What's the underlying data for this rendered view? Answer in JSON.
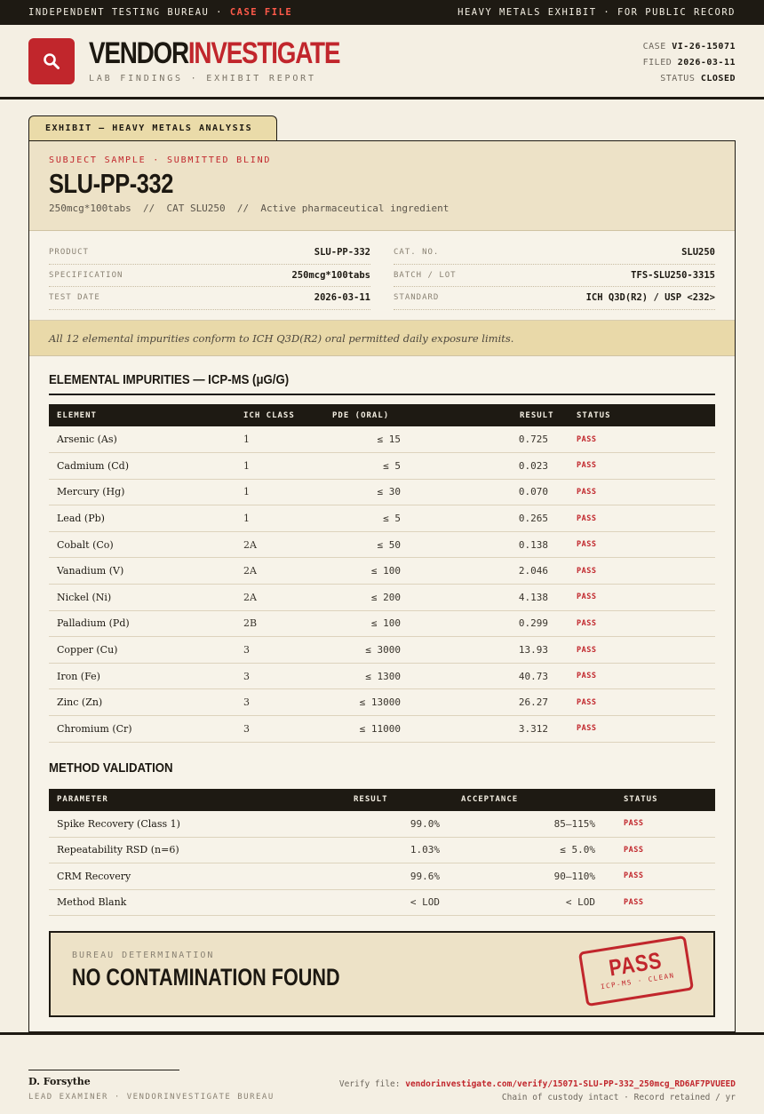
{
  "topbar": {
    "left": "INDEPENDENT TESTING BUREAU · ",
    "left_hl": "CASE FILE",
    "right": "HEAVY METALS EXHIBIT · FOR PUBLIC RECORD"
  },
  "header": {
    "brand_a": "VENDOR",
    "brand_b": "INVESTIGATE",
    "subtitle": "LAB FINDINGS · EXHIBIT REPORT",
    "case_label": "CASE",
    "case_value": "VI-26-15071",
    "filed_label": "FILED",
    "filed_value": "2026-03-11",
    "status_label": "STATUS",
    "status_value": "CLOSED",
    "logo_icon": "magnifier-icon",
    "accent": "#c1262c"
  },
  "exhibit": {
    "tab": "EXHIBIT — HEAVY METALS ANALYSIS",
    "subject_label": "SUBJECT SAMPLE · SUBMITTED BLIND",
    "title": "SLU-PP-332",
    "desc": "250mcg*100tabs  //  CAT SLU250  //  Active pharmaceutical ingredient",
    "specs_left": [
      {
        "k": "PRODUCT",
        "v": "SLU-PP-332"
      },
      {
        "k": "SPECIFICATION",
        "v": "250mcg*100tabs"
      },
      {
        "k": "TEST DATE",
        "v": "2026-03-11"
      }
    ],
    "specs_right": [
      {
        "k": "CAT. NO.",
        "v": "SLU250"
      },
      {
        "k": "BATCH / LOT",
        "v": "TFS-SLU250-3315"
      },
      {
        "k": "STANDARD",
        "v": "ICH Q3D(R2) / USP <232>"
      }
    ],
    "summary": "All 12 elemental impurities conform to ICH Q3D(R2) oral permitted daily exposure limits."
  },
  "elemental": {
    "title": "ELEMENTAL IMPURITIES — ICP-MS (μG/G)",
    "headers": [
      "ELEMENT",
      "ICH CLASS",
      "PDE (ORAL)",
      "RESULT",
      "STATUS"
    ],
    "rows": [
      [
        "Arsenic (As)",
        "1",
        "≤ 15",
        "0.725",
        "PASS"
      ],
      [
        "Cadmium (Cd)",
        "1",
        "≤ 5",
        "0.023",
        "PASS"
      ],
      [
        "Mercury (Hg)",
        "1",
        "≤ 30",
        "0.070",
        "PASS"
      ],
      [
        "Lead (Pb)",
        "1",
        "≤ 5",
        "0.265",
        "PASS"
      ],
      [
        "Cobalt (Co)",
        "2A",
        "≤ 50",
        "0.138",
        "PASS"
      ],
      [
        "Vanadium (V)",
        "2A",
        "≤ 100",
        "2.046",
        "PASS"
      ],
      [
        "Nickel (Ni)",
        "2A",
        "≤ 200",
        "4.138",
        "PASS"
      ],
      [
        "Palladium (Pd)",
        "2B",
        "≤ 100",
        "0.299",
        "PASS"
      ],
      [
        "Copper (Cu)",
        "3",
        "≤ 3000",
        "13.93",
        "PASS"
      ],
      [
        "Iron (Fe)",
        "3",
        "≤ 1300",
        "40.73",
        "PASS"
      ],
      [
        "Zinc (Zn)",
        "3",
        "≤ 13000",
        "26.27",
        "PASS"
      ],
      [
        "Chromium (Cr)",
        "3",
        "≤ 11000",
        "3.312",
        "PASS"
      ]
    ]
  },
  "validation": {
    "title": "METHOD VALIDATION",
    "headers": [
      "PARAMETER",
      "RESULT",
      "ACCEPTANCE",
      "STATUS"
    ],
    "rows": [
      [
        "Spike Recovery (Class 1)",
        "99.0%",
        "85–115%",
        "PASS"
      ],
      [
        "Repeatability RSD (n=6)",
        "1.03%",
        "≤ 5.0%",
        "PASS"
      ],
      [
        "CRM Recovery",
        "99.6%",
        "90–110%",
        "PASS"
      ],
      [
        "Method Blank",
        "< LOD",
        "< LOD",
        "PASS"
      ]
    ]
  },
  "verdict": {
    "label": "BUREAU DETERMINATION",
    "text": "NO CONTAMINATION FOUND",
    "stamp_main": "PASS",
    "stamp_sub": "ICP-MS · CLEAN"
  },
  "footer": {
    "signer": "D. Forsythe",
    "role": "LEAD EXAMINER · VENDORINVESTIGATE BUREAU",
    "verify_label": "Verify file: ",
    "verify_url": "vendorinvestigate.com/verify/15071-SLU-PP-332_250mcg_RD6AF7PVUEED",
    "custody": "Chain of custody intact · Record retained / yr"
  }
}
